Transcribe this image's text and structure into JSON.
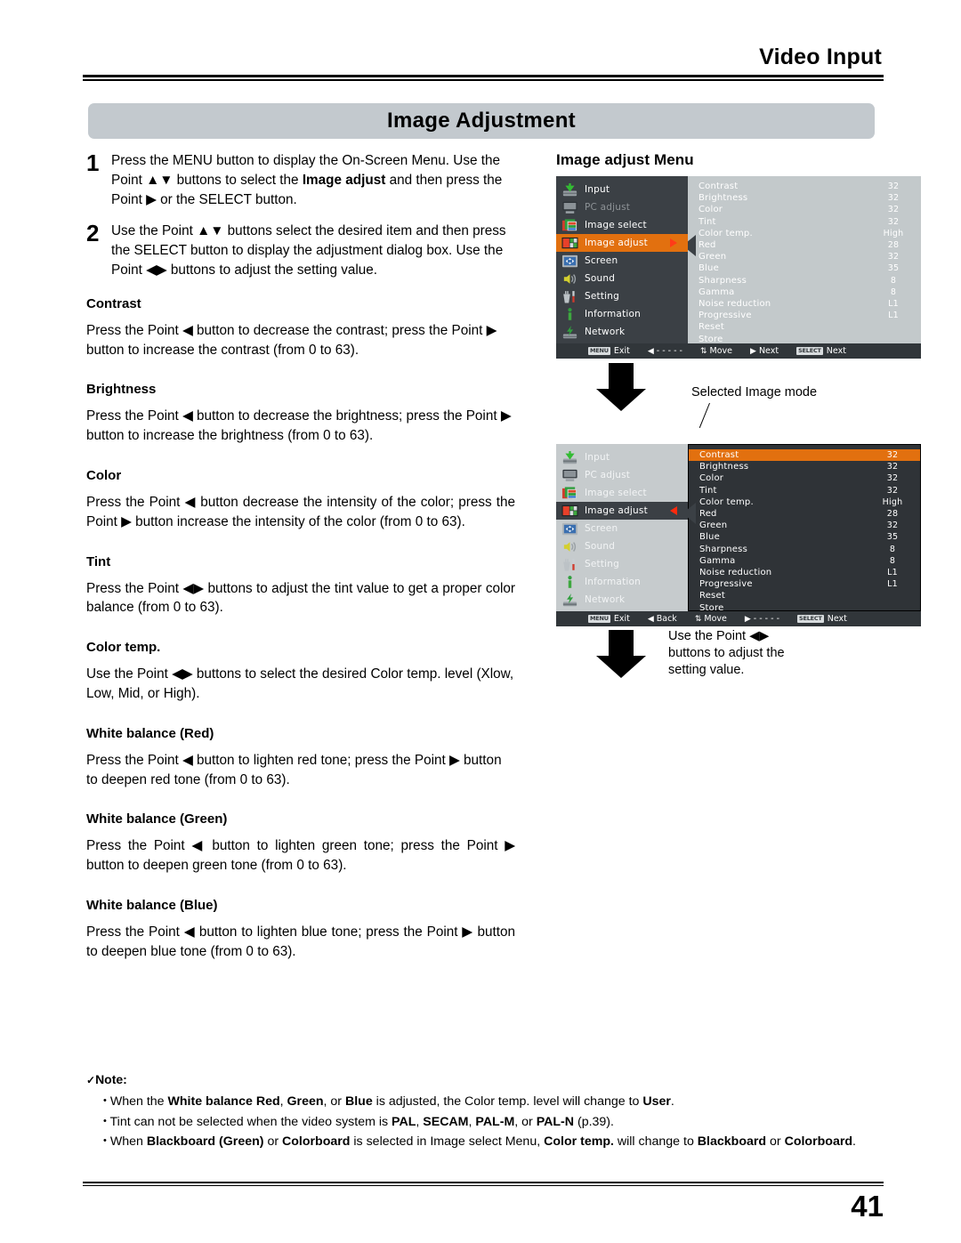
{
  "header": {
    "title": "Video Input"
  },
  "title_bar": {
    "text": "Image Adjustment"
  },
  "steps": [
    {
      "num": "1",
      "html": "Press the MENU button to display the On-Screen Menu. Use the Point ▲▼ buttons to select the <b>Image adjust</b> and then press the Point ▶ or the SELECT button."
    },
    {
      "num": "2",
      "html": "Use the Point ▲▼ buttons select the desired item and then press the SELECT button to display the adjustment dialog box. Use the Point ◀▶ buttons to adjust the setting value."
    }
  ],
  "sections": [
    {
      "heading": "Contrast",
      "body": "Press the Point ◀ button to decrease the contrast; press the Point ▶ button to increase the contrast (from 0 to 63)."
    },
    {
      "heading": "Brightness",
      "body": "Press the Point ◀ button to decrease the brightness; press the Point ▶ button to increase the brightness (from 0 to 63)."
    },
    {
      "heading": "Color",
      "body": "Press the Point ◀ button decrease the intensity of the color; press the Point ▶ button increase the intensity of the color (from 0 to 63)."
    },
    {
      "heading": "Tint",
      "body": "Press the Point ◀▶ buttons to adjust the tint value to get a proper color balance (from 0 to 63)."
    },
    {
      "heading": "Color temp.",
      "body": "Use the Point ◀▶ buttons to select the desired Color temp. level (Xlow, Low, Mid, or High)."
    },
    {
      "heading": "White balance (Red)",
      "body": "Press the Point ◀ button to lighten red tone; press the Point ▶ button to deepen red tone (from 0 to 63)."
    },
    {
      "heading": "White balance (Green)",
      "body": "Press the Point ◀ button to lighten green tone; press the Point ▶ button to deepen green tone (from 0 to 63)."
    },
    {
      "heading": "White balance (Blue)",
      "body": "Press the Point ◀ button to lighten blue tone; press the Point ▶ button to deepen blue tone (from 0 to 63)."
    }
  ],
  "note": {
    "label": "Note:",
    "check": "✓",
    "items": [
      "When the <b>White balance Red</b>, <b>Green</b>, or <b>Blue</b> is adjusted, the Color temp. level will change to <b>User</b>.",
      "Tint can not be selected when the video system is <b>PAL</b>, <b>SECAM</b>, <b>PAL-M</b>, or <b>PAL-N</b> (p.39).",
      "When <b>Blackboard (Green)</b> or <b>Colorboard</b> is selected in Image select Menu, <b>Color temp.</b> will change to <b>Blackboard</b> or <b>Colorboard</b>."
    ]
  },
  "right": {
    "heading": "Image adjust Menu",
    "callout_selected_mode": "Selected Image mode",
    "callout_use_point": "Use the Point ◀▶\nbuttons to adjust the\nsetting value."
  },
  "osd": {
    "sidebar": [
      {
        "label": "Input",
        "icon": "input-icon",
        "state": "normal"
      },
      {
        "label": "PC adjust",
        "icon": "pc-adjust-icon",
        "state": "dim"
      },
      {
        "label": "Image select",
        "icon": "image-select-icon",
        "state": "normal"
      },
      {
        "label": "Image adjust",
        "icon": "image-adjust-icon",
        "state": "selected"
      },
      {
        "label": "Screen",
        "icon": "screen-icon",
        "state": "normal"
      },
      {
        "label": "Sound",
        "icon": "sound-icon",
        "state": "normal"
      },
      {
        "label": "Setting",
        "icon": "setting-icon",
        "state": "normal"
      },
      {
        "label": "Information",
        "icon": "information-icon",
        "state": "normal"
      },
      {
        "label": "Network",
        "icon": "network-icon",
        "state": "normal"
      }
    ],
    "items": [
      {
        "name": "Contrast",
        "value": "32"
      },
      {
        "name": "Brightness",
        "value": "32"
      },
      {
        "name": "Color",
        "value": "32"
      },
      {
        "name": "Tint",
        "value": "32"
      },
      {
        "name": "Color temp.",
        "value": "High"
      },
      {
        "name": "Red",
        "value": "28"
      },
      {
        "name": "Green",
        "value": "32"
      },
      {
        "name": "Blue",
        "value": "35"
      },
      {
        "name": "Sharpness",
        "value": "8"
      },
      {
        "name": "Gamma",
        "value": "8"
      },
      {
        "name": "Noise reduction",
        "value": "L1"
      },
      {
        "name": "Progressive",
        "value": "L1"
      },
      {
        "name": "Reset",
        "value": ""
      },
      {
        "name": "Store",
        "value": ""
      }
    ],
    "footer_top": [
      {
        "key": "MENU",
        "glyph": "",
        "label": "Exit"
      },
      {
        "key": "",
        "glyph": "◀",
        "label": "- - - - -"
      },
      {
        "key": "",
        "glyph": "⇅",
        "label": "Move"
      },
      {
        "key": "",
        "glyph": "▶",
        "label": "Next"
      },
      {
        "key": "SELECT",
        "glyph": "",
        "label": "Next"
      }
    ],
    "footer_bottom": [
      {
        "key": "MENU",
        "glyph": "",
        "label": "Exit"
      },
      {
        "key": "",
        "glyph": "◀",
        "label": "Back"
      },
      {
        "key": "",
        "glyph": "⇅",
        "label": "Move"
      },
      {
        "key": "",
        "glyph": "▶",
        "label": "- - - - -"
      },
      {
        "key": "SELECT",
        "glyph": "",
        "label": "Next"
      }
    ],
    "selected_item": "Contrast"
  },
  "footer": {
    "page_number": "41"
  },
  "colors": {
    "accent_orange": "#e2700f",
    "panel_dark": "#3b4045",
    "panel_light": "#c3c9cb",
    "title_bar": "#c3c9ce",
    "arrow_red": "#ff3b18"
  }
}
